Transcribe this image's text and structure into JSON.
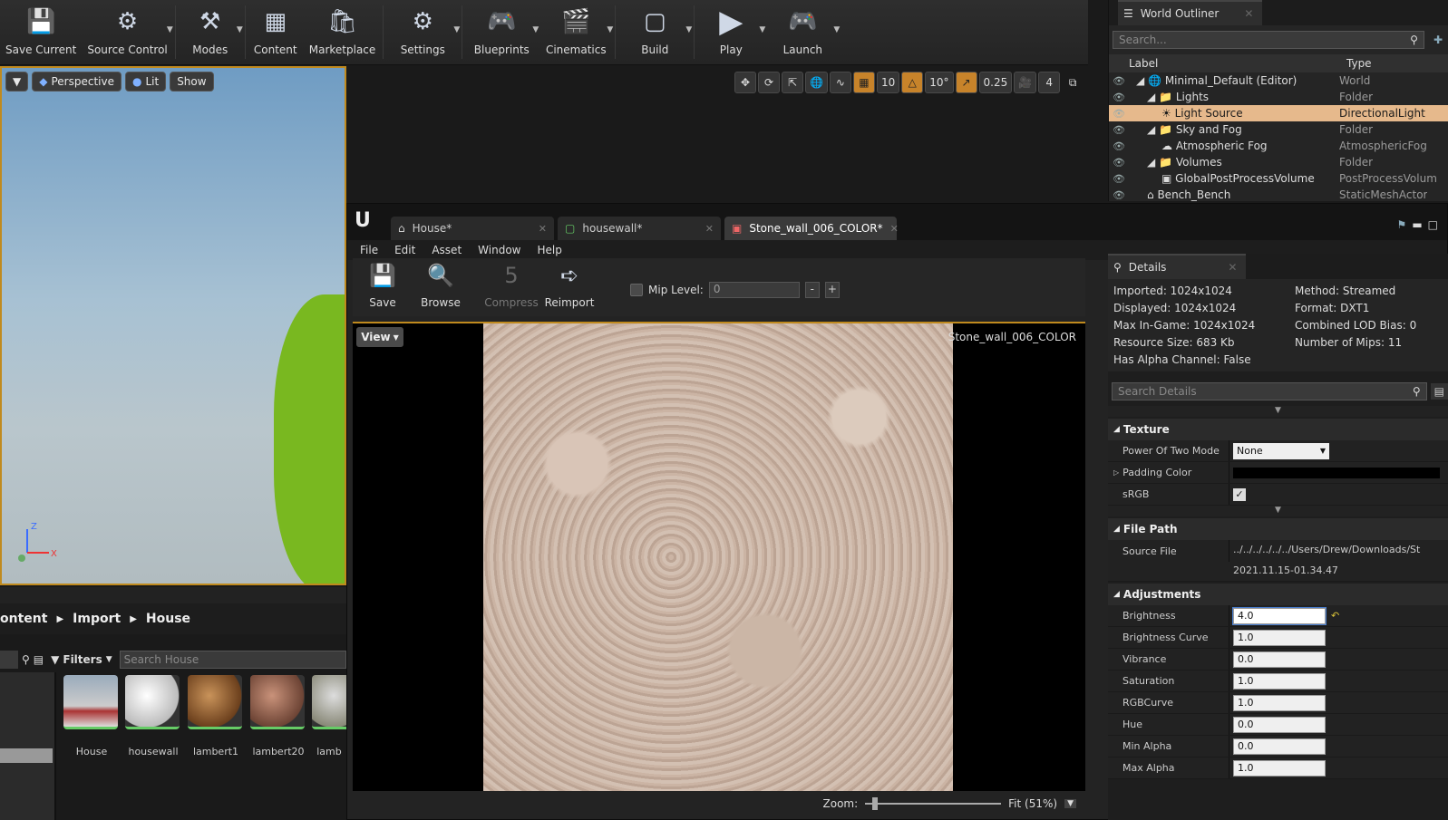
{
  "toolbar": {
    "buttons": [
      {
        "label": "Save Current",
        "icon": "save-icon"
      },
      {
        "label": "Source Control",
        "icon": "source-control-icon"
      },
      {
        "label": "Modes",
        "icon": "modes-icon"
      },
      {
        "label": "Content",
        "icon": "content-icon"
      },
      {
        "label": "Marketplace",
        "icon": "marketplace-icon"
      },
      {
        "label": "Settings",
        "icon": "settings-icon"
      },
      {
        "label": "Blueprints",
        "icon": "blueprints-icon"
      },
      {
        "label": "Cinematics",
        "icon": "cinematics-icon"
      },
      {
        "label": "Build",
        "icon": "build-icon"
      },
      {
        "label": "Play",
        "icon": "play-icon"
      },
      {
        "label": "Launch",
        "icon": "launch-icon"
      }
    ]
  },
  "viewport": {
    "perspective": "Perspective",
    "lit": "Lit",
    "show": "Show",
    "snap_grid": "10",
    "snap_rot": "10°",
    "snap_scale": "0.25",
    "cam_speed": "4",
    "axis_z": "Z",
    "axis_x": "X"
  },
  "outliner": {
    "title": "World Outliner",
    "search_placeholder": "Search...",
    "col_label": "Label",
    "col_type": "Type",
    "rows": [
      {
        "label": "Minimal_Default (Editor)",
        "type": "World"
      },
      {
        "label": "Lights",
        "type": "Folder"
      },
      {
        "label": "Light Source",
        "type": "DirectionalLight"
      },
      {
        "label": "Sky and Fog",
        "type": "Folder"
      },
      {
        "label": "Atmospheric Fog",
        "type": "AtmosphericFog"
      },
      {
        "label": "Volumes",
        "type": "Folder"
      },
      {
        "label": "GlobalPostProcessVolume",
        "type": "PostProcessVolum"
      },
      {
        "label": "Bench_Bench",
        "type": "StaticMeshActor"
      }
    ]
  },
  "content_browser": {
    "path": [
      "ontent",
      "Import",
      "House"
    ],
    "filters": "Filters",
    "search_placeholder": "Search House",
    "assets": [
      "House",
      "housewall",
      "lambert1",
      "lambert20",
      "lamb"
    ]
  },
  "editor": {
    "tabs": [
      "House*",
      "housewall*",
      "Stone_wall_006_COLOR*"
    ],
    "menu": [
      "File",
      "Edit",
      "Asset",
      "Window",
      "Help"
    ],
    "tools": [
      "Save",
      "Browse",
      "Compress",
      "Reimport"
    ],
    "mip_label": "Mip Level:",
    "mip_value": "0",
    "view_btn": "View",
    "texture_name": "Stone_wall_006_COLOR",
    "zoom_label": "Zoom:",
    "zoom_value": "Fit (51%)"
  },
  "details": {
    "title": "Details",
    "info": [
      "Imported: 1024x1024",
      "Method: Streamed",
      "Displayed: 1024x1024",
      "Format: DXT1",
      "Max In-Game: 1024x1024",
      "Combined LOD Bias: 0",
      "Resource Size: 683 Kb",
      "Number of Mips: 11",
      "Has Alpha Channel: False",
      ""
    ],
    "search_placeholder": "Search Details",
    "texture_cat": "Texture",
    "power_label": "Power Of Two Mode",
    "power_value": "None",
    "padding_label": "Padding Color",
    "srgb_label": "sRGB",
    "filepath_cat": "File Path",
    "source_label": "Source File",
    "source_value": "../../../../../../Users/Drew/Downloads/St",
    "source_time": "2021.11.15-01.34.47",
    "adjust_cat": "Adjustments",
    "adjust": [
      {
        "label": "Brightness",
        "value": "4.0"
      },
      {
        "label": "Brightness Curve",
        "value": "1.0"
      },
      {
        "label": "Vibrance",
        "value": "0.0"
      },
      {
        "label": "Saturation",
        "value": "1.0"
      },
      {
        "label": "RGBCurve",
        "value": "1.0"
      },
      {
        "label": "Hue",
        "value": "0.0"
      },
      {
        "label": "Min Alpha",
        "value": "0.0"
      },
      {
        "label": "Max Alpha",
        "value": "1.0"
      }
    ]
  }
}
